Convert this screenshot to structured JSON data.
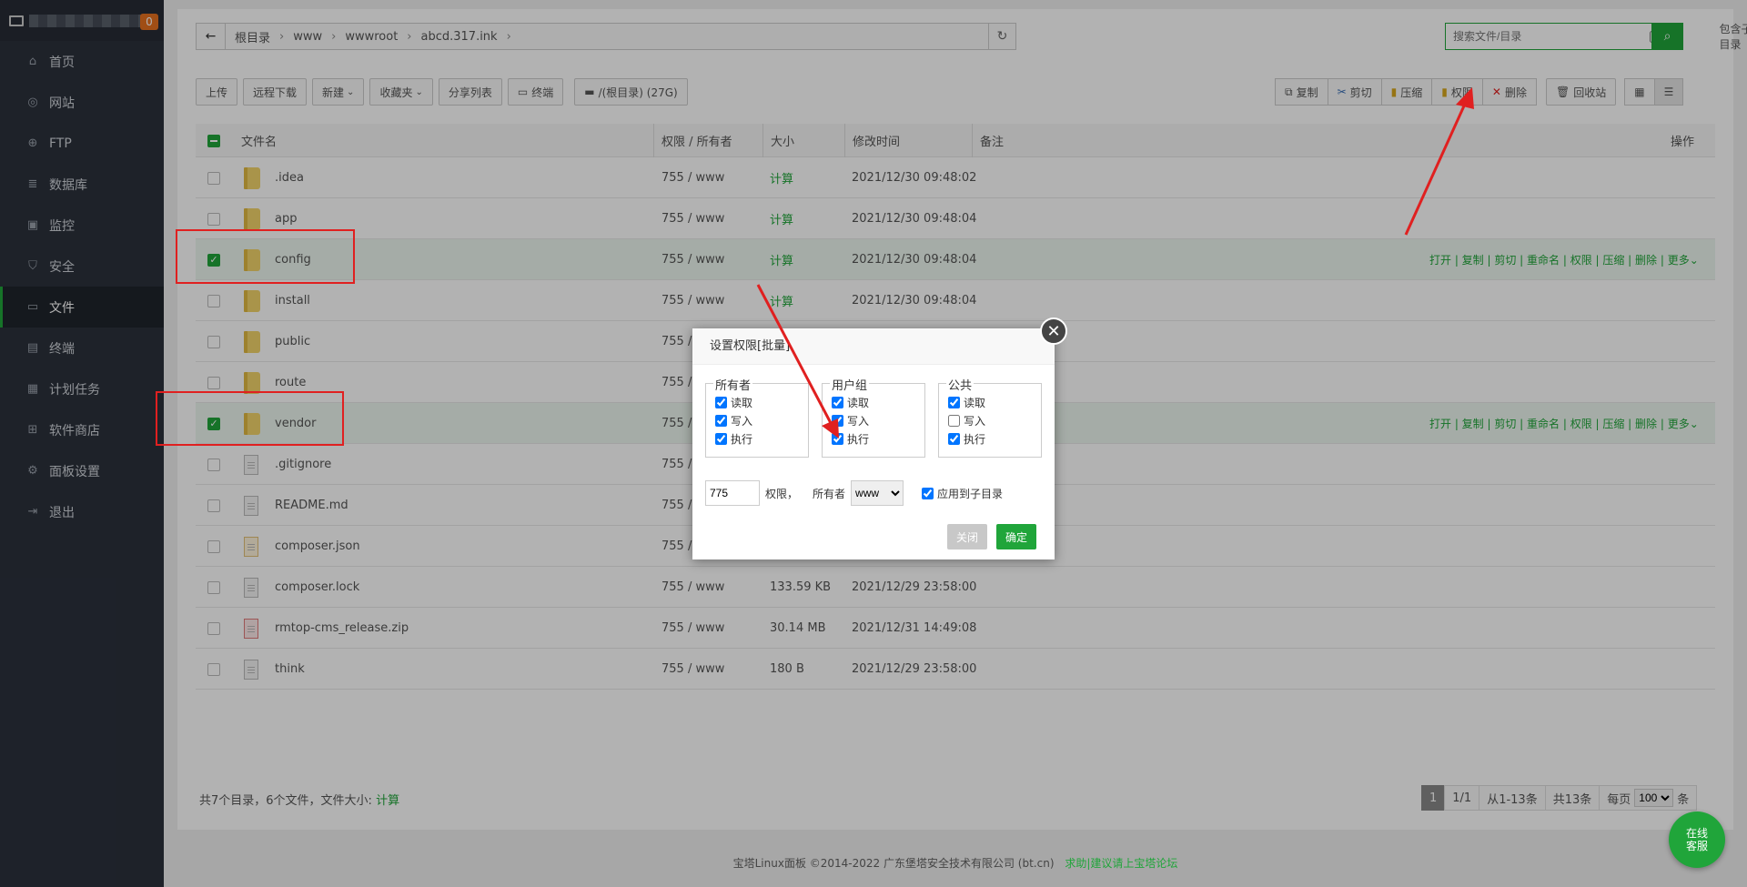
{
  "sidebar": {
    "badge": "0",
    "items": [
      {
        "label": "首页",
        "icon": "home-icon"
      },
      {
        "label": "网站",
        "icon": "globe-icon"
      },
      {
        "label": "FTP",
        "icon": "ftp-icon"
      },
      {
        "label": "数据库",
        "icon": "database-icon"
      },
      {
        "label": "监控",
        "icon": "monitor-icon"
      },
      {
        "label": "安全",
        "icon": "shield-icon"
      },
      {
        "label": "文件",
        "icon": "folder-icon"
      },
      {
        "label": "终端",
        "icon": "terminal-icon"
      },
      {
        "label": "计划任务",
        "icon": "calendar-icon"
      },
      {
        "label": "软件商店",
        "icon": "apps-icon"
      },
      {
        "label": "面板设置",
        "icon": "gear-icon"
      },
      {
        "label": "退出",
        "icon": "logout-icon"
      }
    ],
    "active_index": 6
  },
  "path": {
    "crumbs": [
      "根目录",
      "www",
      "wwwroot",
      "abcd.317.ink"
    ]
  },
  "search": {
    "placeholder": "搜索文件/目录",
    "include_sub_label": "包含子目录"
  },
  "toolbar": {
    "upload": "上传",
    "remote_download": "远程下载",
    "new": "新建",
    "favorites": "收藏夹",
    "share_list": "分享列表",
    "terminal": "终端",
    "disk": "/(根目录) (27G)",
    "copy": "复制",
    "cut": "剪切",
    "compress": "压缩",
    "permission": "权限",
    "delete": "删除",
    "recycle": "回收站"
  },
  "table": {
    "headers": {
      "name": "文件名",
      "perm": "权限 / 所有者",
      "size": "大小",
      "mtime": "修改时间",
      "note": "备注",
      "ops": "操作"
    },
    "rows": [
      {
        "name": ".idea",
        "type": "folder",
        "perm": "755 / www",
        "size": "计算",
        "mtime": "2021/12/30 09:48:02",
        "selected": false
      },
      {
        "name": "app",
        "type": "folder",
        "perm": "755 / www",
        "size": "计算",
        "mtime": "2021/12/30 09:48:04",
        "selected": false
      },
      {
        "name": "config",
        "type": "folder",
        "perm": "755 / www",
        "size": "计算",
        "mtime": "2021/12/30 09:48:04",
        "selected": true
      },
      {
        "name": "install",
        "type": "folder",
        "perm": "755 / www",
        "size": "计算",
        "mtime": "2021/12/30 09:48:04",
        "selected": false
      },
      {
        "name": "public",
        "type": "folder",
        "perm": "755 / www",
        "size": "",
        "mtime": "",
        "selected": false
      },
      {
        "name": "route",
        "type": "folder",
        "perm": "755 / www",
        "size": "",
        "mtime": "",
        "selected": false
      },
      {
        "name": "vendor",
        "type": "folder",
        "perm": "755 / www",
        "size": "",
        "mtime": "",
        "selected": true
      },
      {
        "name": ".gitignore",
        "type": "file",
        "perm": "755 / www",
        "size": "",
        "mtime": "",
        "selected": false
      },
      {
        "name": "README.md",
        "type": "file",
        "perm": "755 / www",
        "size": "",
        "mtime": "",
        "selected": false
      },
      {
        "name": "composer.json",
        "type": "json",
        "perm": "755 / www",
        "size": "",
        "mtime": "",
        "selected": false
      },
      {
        "name": "composer.lock",
        "type": "file",
        "perm": "755 / www",
        "size": "133.59 KB",
        "mtime": "2021/12/29 23:58:00",
        "selected": false
      },
      {
        "name": "rmtop-cms_release.zip",
        "type": "zip",
        "perm": "755 / www",
        "size": "30.14 MB",
        "mtime": "2021/12/31 14:49:08",
        "selected": false
      },
      {
        "name": "think",
        "type": "file",
        "perm": "755 / www",
        "size": "180 B",
        "mtime": "2021/12/29 23:58:00",
        "selected": false
      }
    ],
    "row_ops": "打开 | 复制 | 剪切 | 重命名 | 权限 | 压缩 | 删除 | 更多"
  },
  "footer": {
    "summary": "共7个目录，6个文件，文件大小:",
    "calc": "计算",
    "page_current": "1",
    "page_total": "1/1",
    "range": "从1-13条",
    "total": "共13条",
    "per_page_label": "每页",
    "per_page_value": "100",
    "per_page_suffix": "条"
  },
  "copyright": {
    "text": "宝塔Linux面板 ©2014-2022 广东堡塔安全技术有限公司 (bt.cn)",
    "link": "求助|建议请上宝塔论坛"
  },
  "online_service": "在线客服",
  "dialog": {
    "title": "设置权限[批量]",
    "groups": [
      {
        "legend": "所有者",
        "read": true,
        "write": true,
        "exec": true
      },
      {
        "legend": "用户组",
        "read": true,
        "write": true,
        "exec": true
      },
      {
        "legend": "公共",
        "read": true,
        "write": false,
        "exec": true
      }
    ],
    "labels": {
      "read": "读取",
      "write": "写入",
      "exec": "执行"
    },
    "perm_value": "775",
    "perm_label": "权限，",
    "owner_label": "所有者",
    "owner_value": "www",
    "apply_sub": "应用到子目录",
    "close_btn": "关闭",
    "ok_btn": "确定"
  },
  "colors": {
    "accent": "#20a53a",
    "sidebar": "#2b313c",
    "annotation": "#e02020"
  }
}
